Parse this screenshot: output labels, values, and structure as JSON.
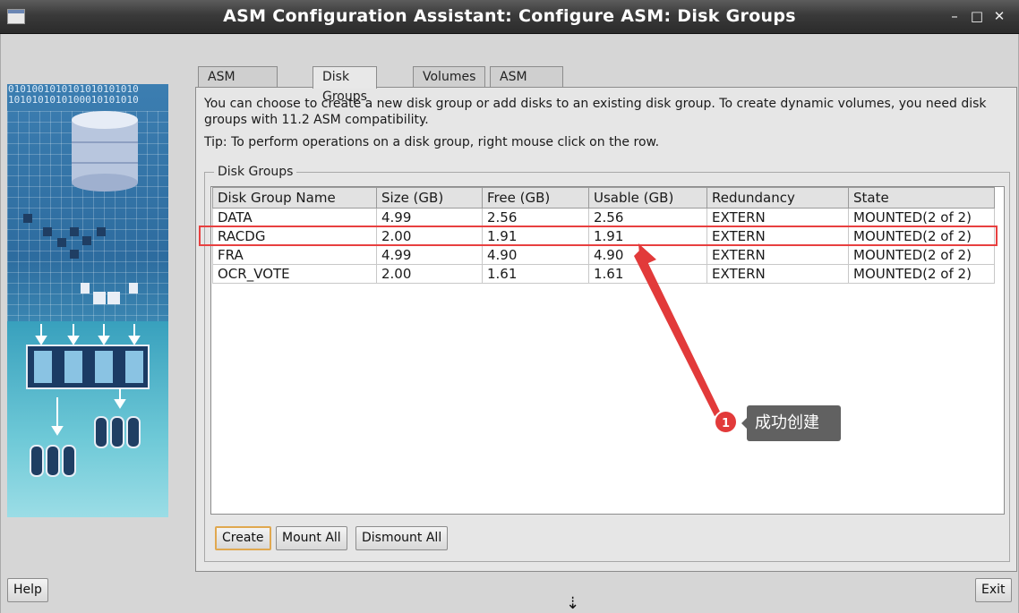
{
  "window": {
    "title": "ASM Configuration Assistant: Configure ASM: Disk Groups",
    "controls": {
      "minimize": "–",
      "maximize": "□",
      "close": "✕"
    }
  },
  "side_art": {
    "bits": [
      "0101001010101010101010",
      "1010101010100010101010"
    ]
  },
  "tabs": [
    {
      "label": "ASM Instances",
      "active": false
    },
    {
      "label": "Disk Groups",
      "active": true
    },
    {
      "label": "Volumes",
      "active": false
    },
    {
      "label": "ASM Cluster File Systems",
      "active": false
    }
  ],
  "panel": {
    "description": "You can choose to create a new disk group or add disks to an existing disk group. To create dynamic volumes, you need disk groups with 11.2 ASM compatibility.",
    "tip": "Tip: To perform operations on a disk group, right mouse click on the row.",
    "group_label": "Disk Groups"
  },
  "table": {
    "columns": [
      "Disk Group Name",
      "Size (GB)",
      "Free (GB)",
      "Usable (GB)",
      "Redundancy",
      "State"
    ],
    "rows": [
      [
        "DATA",
        "4.99",
        "2.56",
        "2.56",
        "EXTERN",
        "MOUNTED(2 of 2)"
      ],
      [
        "RACDG",
        "2.00",
        "1.91",
        "1.91",
        "EXTERN",
        "MOUNTED(2 of 2)"
      ],
      [
        "FRA",
        "4.99",
        "4.90",
        "4.90",
        "EXTERN",
        "MOUNTED(2 of 2)"
      ],
      [
        "OCR_VOTE",
        "2.00",
        "1.61",
        "1.61",
        "EXTERN",
        "MOUNTED(2 of 2)"
      ]
    ]
  },
  "buttons": {
    "create": "Create",
    "mount_all": "Mount All",
    "dismount_all": "Dismount All",
    "help": "Help",
    "exit": "Exit"
  },
  "annotation": {
    "badge": "1",
    "text": "成功创建",
    "highlight_color": "#e84040"
  },
  "status_icon": "⇣"
}
